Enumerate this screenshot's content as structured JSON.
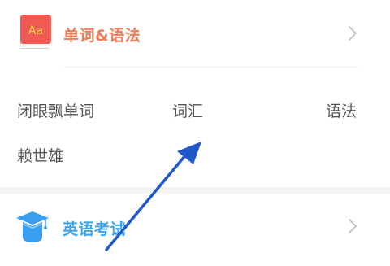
{
  "vocab_section": {
    "icon_text": "Aa",
    "title": "单词&语法",
    "title_color": "#ef7a58",
    "links": [
      "闭眼飘单词",
      "词汇",
      "语法",
      "赖世雄"
    ]
  },
  "exam_section": {
    "title": "英语考试",
    "title_color": "#3ba5f0"
  },
  "colors": {
    "icon_red": "#f15a52",
    "icon_blue": "#3a9ff0",
    "chevron": "#c0c0c0",
    "arrow": "#2057c9",
    "link_text": "#555555"
  },
  "icons": {
    "vocab_icon": "red-book-icon",
    "exam_icon": "graduation-cap-icon",
    "chevron": "chevron-right-icon",
    "annotation": "blue-arrow-annotation"
  }
}
